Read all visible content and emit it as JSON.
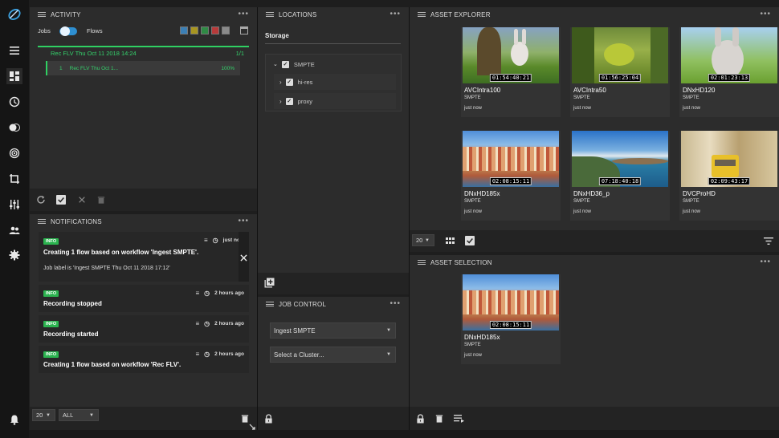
{
  "activity": {
    "title": "ACTIVITY",
    "jobs_label": "Jobs",
    "flows_label": "Flows",
    "filter_colors": [
      "#3b7fb5",
      "#a89520",
      "#2f8a45",
      "#b83a3a",
      "#8a8a8a"
    ],
    "job": {
      "title": "Rec FLV Thu Oct 11 2018 14:24",
      "count": "1/1",
      "step_index": "1",
      "step_name": "Rec FLV Thu Oct 1...",
      "progress_text": "100%",
      "progress": 1.0
    }
  },
  "notifications": {
    "title": "NOTIFICATIONS",
    "page_size": "20",
    "filter": "ALL",
    "items": [
      {
        "badge": "INFO",
        "time": "just now",
        "message": "Creating 1 flow based on workflow 'Ingest SMPTE'.",
        "detail": "Job label is 'Ingest SMPTE Thu Oct 11 2018 17:12'"
      },
      {
        "badge": "INFO",
        "time": "2 hours ago",
        "message": "Recording stopped"
      },
      {
        "badge": "INFO",
        "time": "2 hours ago",
        "message": "Recording started"
      },
      {
        "badge": "INFO",
        "time": "2 hours ago",
        "message": "Creating 1 flow based on workflow 'Rec FLV'."
      }
    ]
  },
  "locations": {
    "title": "LOCATIONS",
    "section": "Storage",
    "root": "SMPTE",
    "children": [
      "hi-res",
      "proxy"
    ]
  },
  "job_control": {
    "title": "JOB CONTROL",
    "workflow": "Ingest SMPTE",
    "cluster": "Select a Cluster..."
  },
  "asset_explorer": {
    "title": "ASSET EXPLORER",
    "page_size": "20",
    "assets": [
      {
        "name": "AVCIntra100",
        "location": "SMPTE",
        "time": "just now",
        "timecode": "01:54:40:21"
      },
      {
        "name": "AVCIntra50",
        "location": "SMPTE",
        "time": "just now",
        "timecode": "01:56:25:04"
      },
      {
        "name": "DNxHD120",
        "location": "SMPTE",
        "time": "just now",
        "timecode": "02:01:23:13"
      },
      {
        "name": "DNxHD185x",
        "location": "SMPTE",
        "time": "just now",
        "timecode": "02:08:15:11"
      },
      {
        "name": "DNxHD36_p",
        "location": "SMPTE",
        "time": "just now",
        "timecode": "07:18:40:18"
      },
      {
        "name": "DVCProHD",
        "location": "SMPTE",
        "time": "just now",
        "timecode": "02:09:43:17"
      }
    ]
  },
  "asset_selection": {
    "title": "ASSET SELECTION",
    "assets": [
      {
        "name": "DNxHD185x",
        "location": "SMPTE",
        "time": "just now",
        "timecode": "02:08:15:11"
      }
    ]
  },
  "icons": [
    "logo-icon",
    "menu-icon",
    "dashboard-icon",
    "clock-icon",
    "toggle-icon",
    "radar-icon",
    "crop-icon",
    "equalizer-icon",
    "users-icon",
    "gear-icon",
    "bell-icon"
  ]
}
